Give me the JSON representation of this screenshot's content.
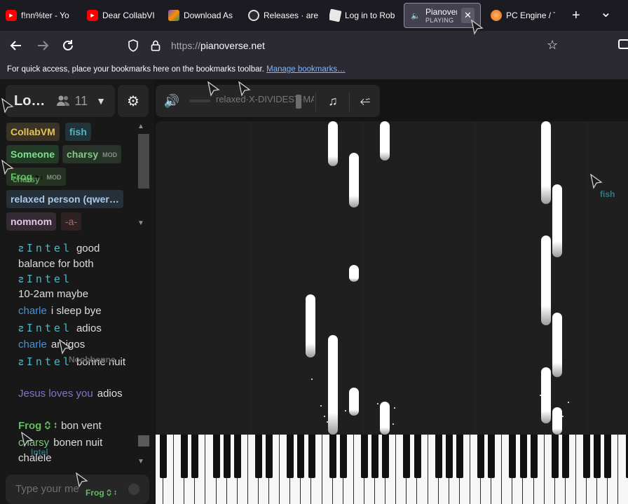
{
  "browser": {
    "tabs": [
      {
        "title": "f!nn%ter - Yo",
        "icon": "youtube-icon"
      },
      {
        "title": "Dear CollabVI",
        "icon": "youtube-icon"
      },
      {
        "title": "Download As",
        "icon": "download-site-icon"
      },
      {
        "title": "Releases · are",
        "icon": "github-icon"
      },
      {
        "title": "Log in to Rob",
        "icon": "roblox-icon"
      },
      {
        "title": "Pianovers",
        "subtitle": "PLAYING",
        "icon": "speaker-icon",
        "active": true
      },
      {
        "title": "PC Engine / T",
        "icon": "pc-engine-icon"
      }
    ],
    "new_tab": "+",
    "list_tabs": "⌄",
    "url_scheme": "https://",
    "url_host": "pianoverse.net",
    "bookmarks_text": "For quick access, place your bookmarks here on the bookmarks toolbar.",
    "bookmarks_link": "Manage bookmarks…"
  },
  "room": {
    "name": "Lo…",
    "user_count": "11"
  },
  "users": [
    {
      "name": "nomnom",
      "color": "#d6b3d6",
      "ghost": true
    },
    {
      "name": "CollabVM",
      "color": "#e6c25a"
    },
    {
      "name": "fish",
      "color": "#4fb6c4"
    },
    {
      "name": "Someone",
      "color": "#7de08a"
    },
    {
      "name": "charsy",
      "color": "#7fc97f",
      "mod": "MOD"
    },
    {
      "name": "Frog",
      "color": "#5fbf5f",
      "badge": "🯰🯱",
      "mod": "MOD"
    },
    {
      "name": "charsy",
      "color": "#7fc97f",
      "ghost": true
    },
    {
      "name": "relaxed person (qwer…",
      "color": "#a8c8e8"
    },
    {
      "name": "nomnom",
      "color": "#e5c5e5"
    },
    {
      "name": "-a-",
      "color": "#b86a6a"
    }
  ],
  "chat": [
    {
      "nick": "ꙅIntel",
      "nick_style": "intel",
      "text": "good balance for both"
    },
    {
      "nick": "ꙅIntel",
      "nick_style": "intel",
      "text": "10-2am maybe"
    },
    {
      "nick": "charle",
      "color": "#4a90d9",
      "text": "i sleep bye"
    },
    {
      "nick": "ꙅIntel",
      "nick_style": "intel",
      "text": "adios"
    },
    {
      "nick": "charle",
      "color": "#4a90d9",
      "text": "amigos"
    },
    {
      "nick": "ꙅIntel",
      "nick_style": "intel",
      "text": "bonne nuit"
    },
    {
      "nick": "Jesus loves you",
      "color": "#8a6fd1",
      "text": "adios"
    },
    {
      "nick": "Frog 🯰🯱",
      "color": "#5fbf5f",
      "text": "bon vent"
    },
    {
      "nick": "charsy",
      "color": "#7fc97f",
      "text": "bonen nuit chalele"
    }
  ],
  "chat_input": {
    "placeholder": "Type your me"
  },
  "toolbar": {
    "volume_icon": "🔊",
    "marquee": "relaxed·X-DIVIDEST·MAR...",
    "music_icon": "♫",
    "usb_icon": "⭁"
  },
  "cursors": [
    {
      "label": "",
      "color": "#cfcfcf"
    },
    {
      "label": "",
      "color": "#cfcfcf"
    },
    {
      "label": "",
      "color": "#cfcfcf"
    },
    {
      "label": "",
      "color": "#cfcfcf"
    },
    {
      "label": "fish",
      "color": "#2a7f8a"
    },
    {
      "label": "Noobbonne",
      "color": "#666"
    },
    {
      "label": "Intel",
      "color": "#2a6f7a"
    },
    {
      "label": "Frog 🯰🯱",
      "color": "#5fbf5f"
    }
  ]
}
